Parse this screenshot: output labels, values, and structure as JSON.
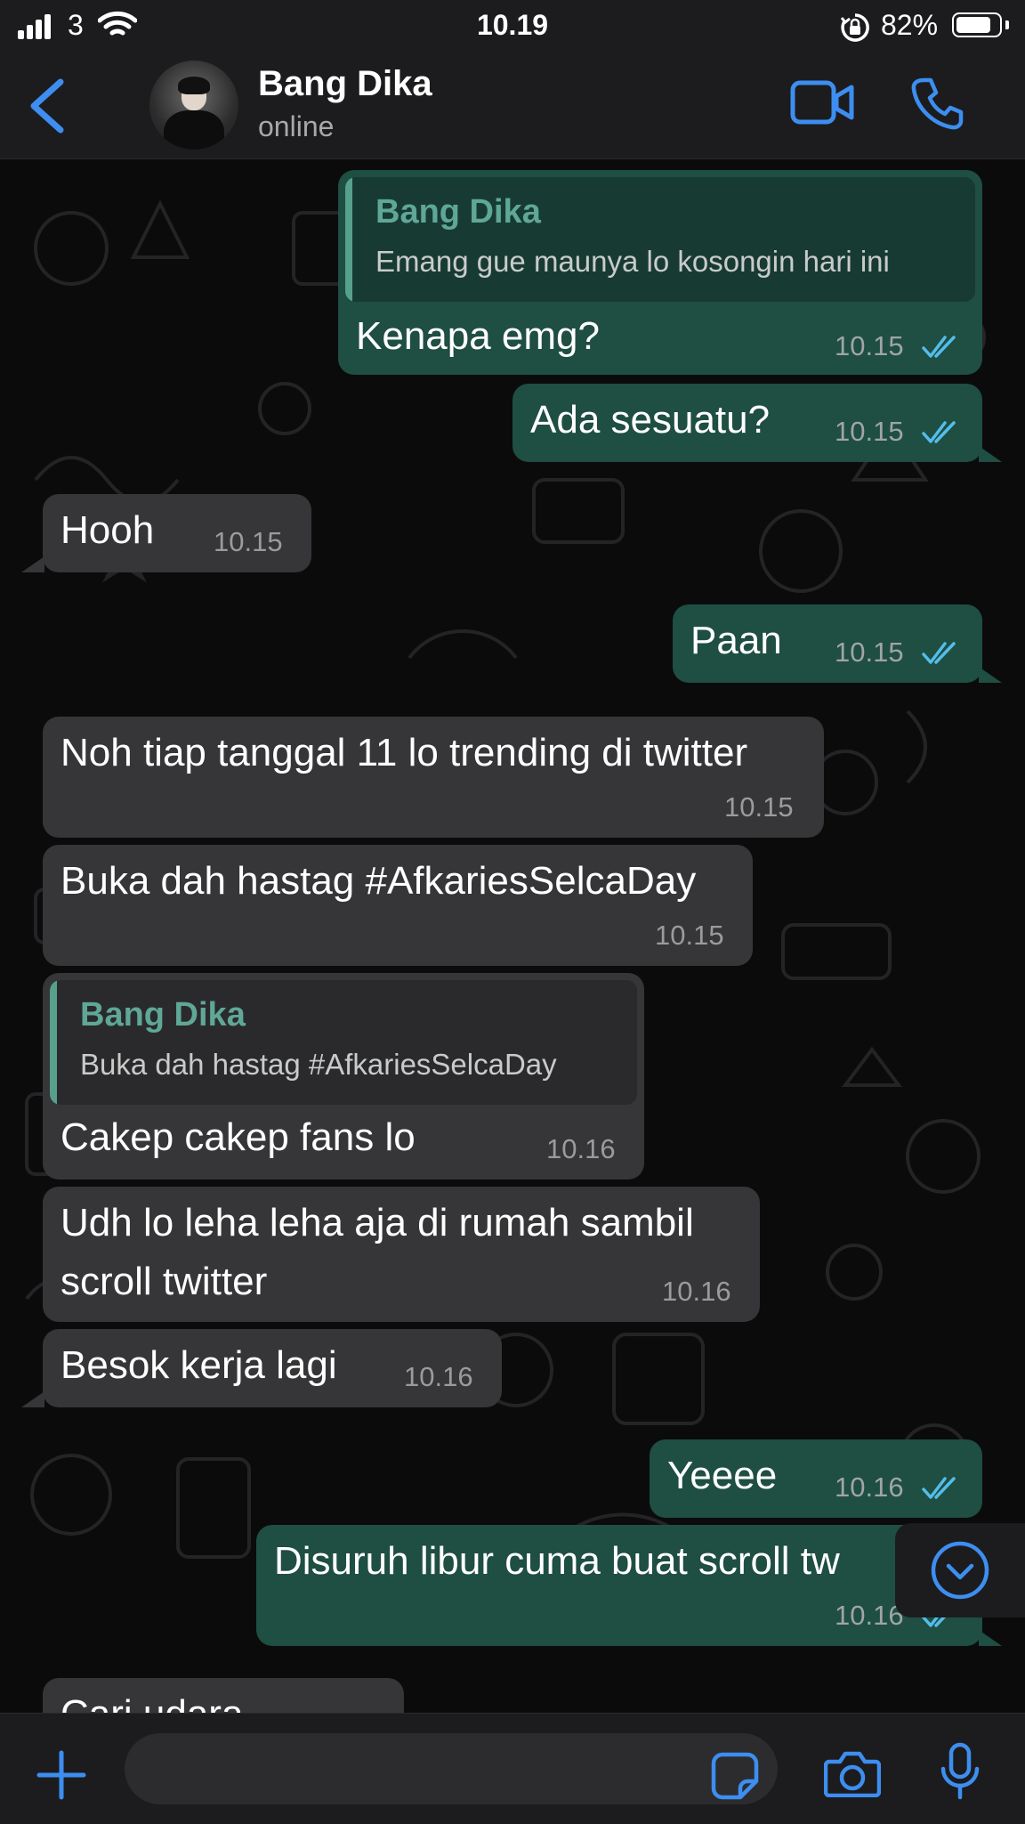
{
  "status_bar": {
    "carrier": "3",
    "time": "10.19",
    "battery_percent": "82%",
    "battery_level": 0.82
  },
  "header": {
    "contact_name": "Bang Dika",
    "contact_status": "online",
    "icons": [
      "chevron-left-icon",
      "video-camera-icon",
      "phone-icon"
    ]
  },
  "messages": [
    {
      "dir": "out",
      "quote_name": "Bang Dika",
      "quote_text": "Emang gue maunya lo kosongin hari ini",
      "text": "Kenapa emg?",
      "time": "10.15",
      "read": true
    },
    {
      "dir": "out",
      "text": "Ada sesuatu?",
      "time": "10.15",
      "read": true
    },
    {
      "dir": "in",
      "text": "Hooh",
      "time": "10.15"
    },
    {
      "dir": "out",
      "text": "Paan",
      "time": "10.15",
      "read": true
    },
    {
      "dir": "in",
      "text": "Noh tiap tanggal 11 lo trending di twitter",
      "time": "10.15"
    },
    {
      "dir": "in",
      "text": "Buka dah hastag #AfkariesSelcaDay",
      "time": "10.15"
    },
    {
      "dir": "in",
      "quote_name": "Bang Dika",
      "quote_text": "Buka dah hastag #AfkariesSelcaDay",
      "text": "Cakep cakep fans lo",
      "time": "10.16"
    },
    {
      "dir": "in",
      "text_line1": "Udh lo leha leha aja di rumah sambil",
      "text_line2": "scroll twitter",
      "time": "10.16"
    },
    {
      "dir": "in",
      "text": "Besok kerja lagi",
      "time": "10.16"
    },
    {
      "dir": "out",
      "text": "Yeeee",
      "time": "10.16",
      "read": true
    },
    {
      "dir": "out",
      "text": "Disuruh libur cuma buat scroll tw",
      "time": "10.16",
      "read": true
    },
    {
      "dir": "in",
      "text": "Cari udara",
      "time": ""
    }
  ],
  "input_bar": {
    "placeholder": "",
    "icons": [
      "plus-icon",
      "sticker-icon",
      "camera-icon",
      "microphone-icon"
    ]
  },
  "colors": {
    "accent": "#3d8ef0",
    "outgoing_bubble": "#1f4e42",
    "incoming_bubble": "#363638",
    "quote_name": "#5fa797",
    "read_ticks": "#53bdeb"
  }
}
